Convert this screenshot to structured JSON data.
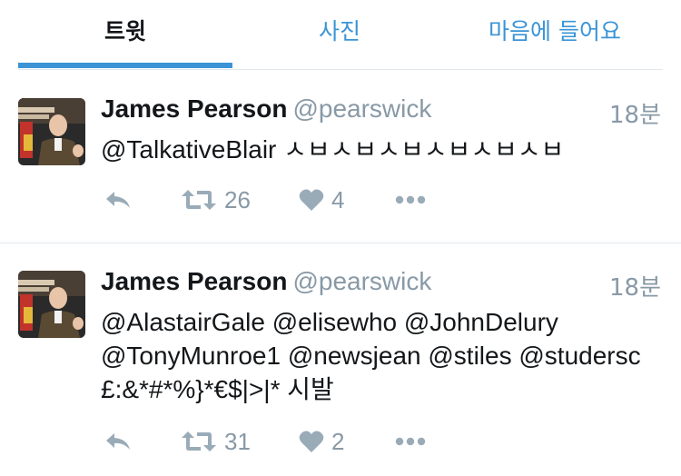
{
  "tabs": {
    "tweets": "트윗",
    "photos": "사진",
    "likes": "마음에 들어요"
  },
  "colors": {
    "accent": "#3a94d6",
    "secondary_text": "#8899a6",
    "action_icon": "#9aabb8"
  },
  "tweets": [
    {
      "display_name": "James Pearson",
      "handle": "@pearswick",
      "time": "18분",
      "text_lines": [
        "@TalkativeBlair ㅅㅂㅅㅂㅅㅂㅅㅂㅅㅂㅅㅂ"
      ],
      "retweets": "26",
      "likes": "4",
      "icons": [
        "reply-icon",
        "retweet-icon",
        "heart-icon",
        "more-icon"
      ]
    },
    {
      "display_name": "James Pearson",
      "handle": "@pearswick",
      "time": "18분",
      "text_lines": [
        "@AlastairGale @elisewho @JohnDelury",
        "@TonyMunroe1 @newsjean @stiles @studersc",
        "£:&*#*%}*€$|>|* 시발"
      ],
      "retweets": "31",
      "likes": "2",
      "icons": [
        "reply-icon",
        "retweet-icon",
        "heart-icon",
        "more-icon"
      ]
    }
  ]
}
